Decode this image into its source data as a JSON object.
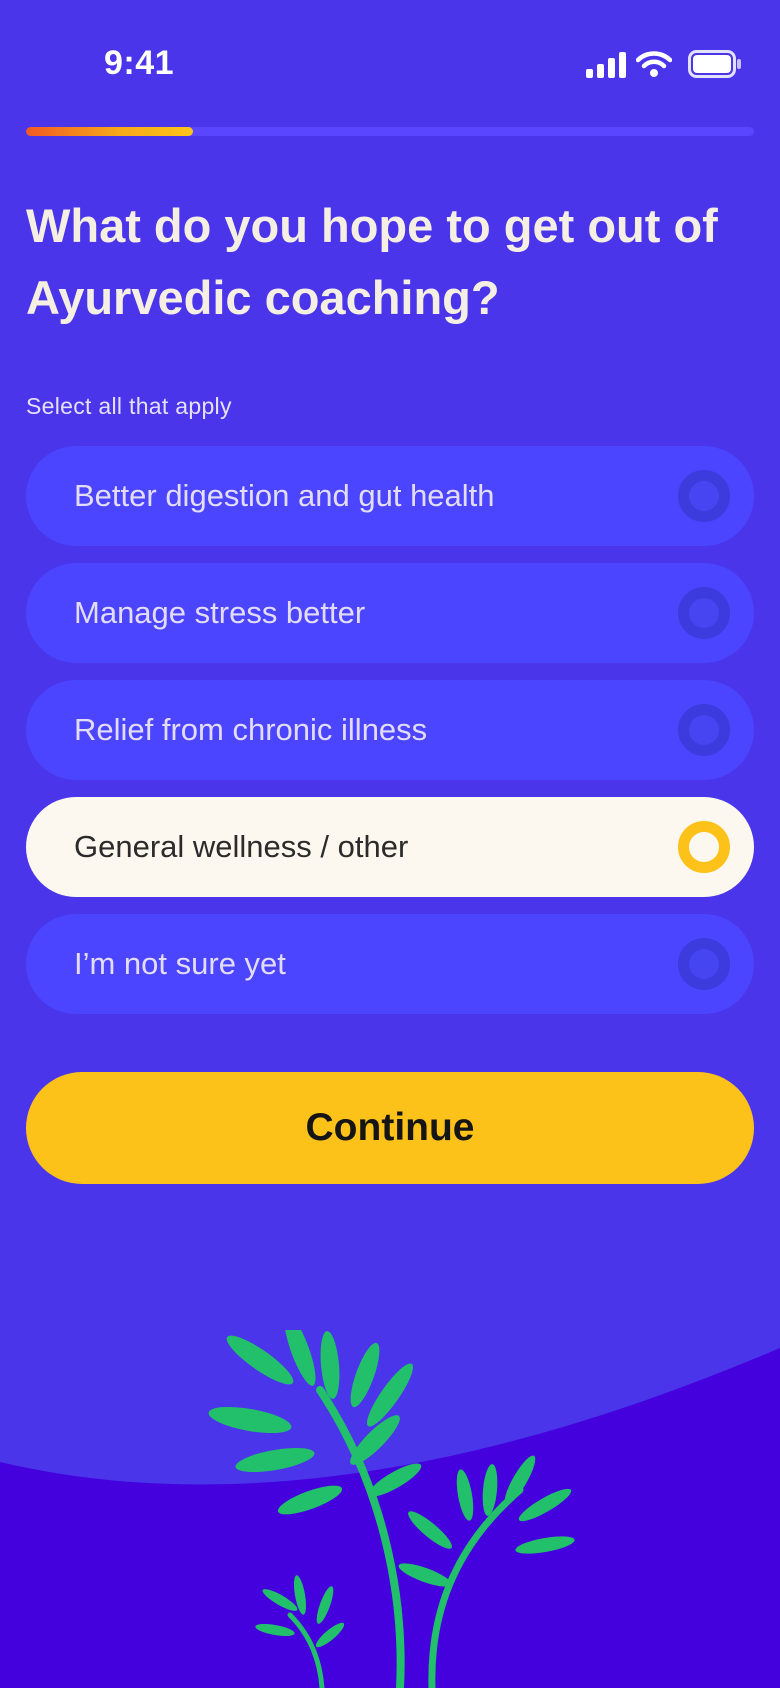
{
  "status_bar": {
    "time": "9:41",
    "signal_icon": "cellular-signal-icon",
    "wifi_icon": "wifi-icon",
    "battery_icon": "battery-icon"
  },
  "progress": {
    "fraction": 0.23
  },
  "question": {
    "title": "What do you hope to get out of Ayurvedic coaching?",
    "hint": "Select all that apply"
  },
  "options": [
    {
      "label": "Better digestion and gut health",
      "selected": false
    },
    {
      "label": "Manage stress better",
      "selected": false
    },
    {
      "label": "Relief from chronic illness",
      "selected": false
    },
    {
      "label": "General wellness / other",
      "selected": true
    },
    {
      "label": "I’m not sure yet",
      "selected": false
    }
  ],
  "continue": {
    "label": "Continue"
  },
  "colors": {
    "background": "#4a35ea",
    "accent": "#fdc21a",
    "option_bg": "#4b45ff",
    "selected_bg": "#fdf8ef",
    "plant": "#22c06a"
  }
}
